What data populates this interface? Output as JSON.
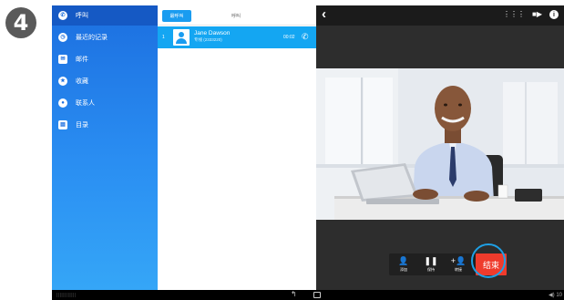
{
  "step": {
    "number": "4"
  },
  "sidebar": {
    "items": [
      {
        "label": "呼叫",
        "icon": "phone-icon",
        "glyph": "✆",
        "active": true
      },
      {
        "label": "最近的记录",
        "icon": "clock-icon",
        "glyph": "◷",
        "active": false
      },
      {
        "label": "邮件",
        "icon": "mail-icon",
        "glyph": "✉",
        "active": false
      },
      {
        "label": "收藏",
        "icon": "star-icon",
        "glyph": "★",
        "active": false
      },
      {
        "label": "联系人",
        "icon": "person-icon",
        "glyph": "●",
        "active": false
      },
      {
        "label": "目录",
        "icon": "directory-icon",
        "glyph": "▤",
        "active": false
      }
    ]
  },
  "middle": {
    "tabs": [
      {
        "label": "最呼叫",
        "selected": true
      },
      {
        "label": "呼叫",
        "selected": false
      }
    ],
    "active_call": {
      "index": "1",
      "name": "Jane Dawson",
      "subtitle": "专线 (2333220)",
      "time": "00:02",
      "icon": "phone-icon"
    }
  },
  "call": {
    "back_icon": "chevron-left-icon",
    "toolbar_icons": [
      "dialpad-icon",
      "video-camera-icon",
      "info-icon"
    ],
    "controls": [
      {
        "label": "添加",
        "icon": "add-participant-icon",
        "glyph": "👤"
      },
      {
        "label": "保持",
        "icon": "pause-icon",
        "glyph": "❚❚"
      },
      {
        "label": "转接",
        "icon": "transfer-icon",
        "glyph": "⇄"
      }
    ],
    "end_label": "结束"
  },
  "navbar": {
    "left_text": "||||||||||||",
    "right_text": "◀) 10"
  },
  "colors": {
    "sidebar_top": "#1c6fe0",
    "sidebar_bottom": "#35a6f7",
    "active_row": "#14a6f2",
    "end_button": "#ef3b2c",
    "highlight_ring": "#1ea0e6"
  }
}
